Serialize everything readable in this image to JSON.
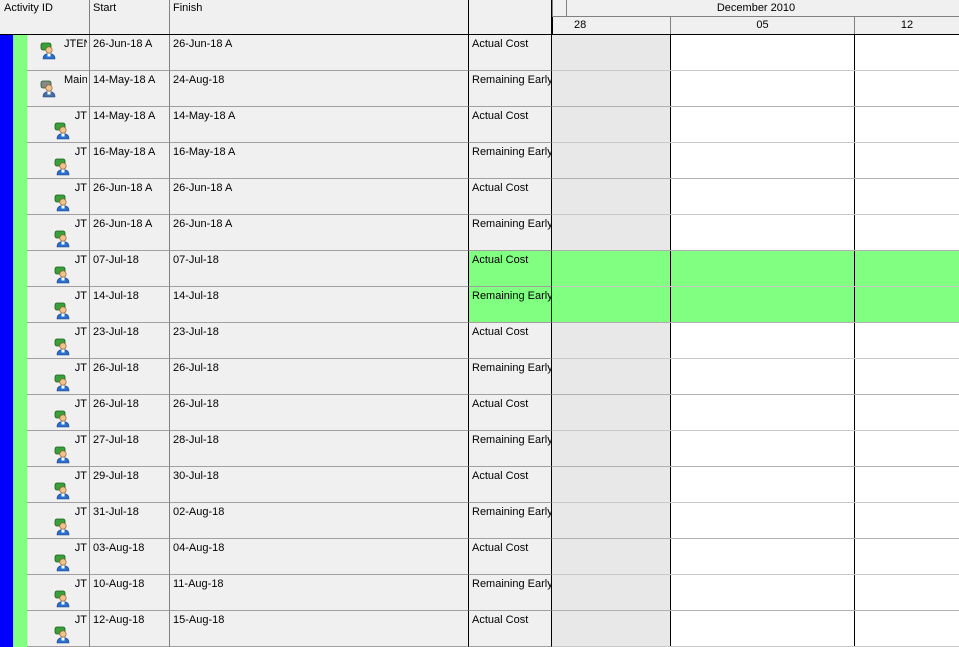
{
  "columns": {
    "activity_id": "Activity ID",
    "start": "Start",
    "finish": "Finish",
    "curve": ""
  },
  "timeline": {
    "month": "December 2010",
    "weeks": [
      "28",
      "05",
      "12"
    ]
  },
  "colors": {
    "band_blue": "#0000ff",
    "band_green": "#80ff80",
    "highlight": "#80ff80"
  },
  "rows": [
    {
      "id": "JTEN",
      "icon": "resource-person-icon",
      "start": "26-Jun-18 A",
      "finish": "26-Jun-18 A",
      "curve": "Actual Cost"
    },
    {
      "id": "Maint",
      "icon": "resource-person-grey-icon",
      "start": "14-May-18 A",
      "finish": "24-Aug-18",
      "curve": "Remaining Early"
    },
    {
      "id": "JT",
      "icon": "resource-person-icon",
      "start": "14-May-18 A",
      "finish": "14-May-18 A",
      "curve": "Actual Cost"
    },
    {
      "id": "JT",
      "icon": "resource-person-icon",
      "start": "16-May-18 A",
      "finish": "16-May-18 A",
      "curve": "Remaining Early"
    },
    {
      "id": "JT",
      "icon": "resource-person-icon",
      "start": "26-Jun-18 A",
      "finish": "26-Jun-18 A",
      "curve": "Actual Cost"
    },
    {
      "id": "JT",
      "icon": "resource-person-icon",
      "start": "26-Jun-18 A",
      "finish": "26-Jun-18 A",
      "curve": "Remaining Early"
    },
    {
      "id": "JT",
      "icon": "resource-person-icon",
      "start": "07-Jul-18",
      "finish": "07-Jul-18",
      "curve": "Actual Cost",
      "highlight": true
    },
    {
      "id": "JT",
      "icon": "resource-person-icon",
      "start": "14-Jul-18",
      "finish": "14-Jul-18",
      "curve": "Remaining Early",
      "highlight": true
    },
    {
      "id": "JT",
      "icon": "resource-person-icon",
      "start": "23-Jul-18",
      "finish": "23-Jul-18",
      "curve": "Actual Cost"
    },
    {
      "id": "JT",
      "icon": "resource-person-icon",
      "start": "26-Jul-18",
      "finish": "26-Jul-18",
      "curve": "Remaining Early"
    },
    {
      "id": "JT",
      "icon": "resource-person-icon",
      "start": "26-Jul-18",
      "finish": "26-Jul-18",
      "curve": "Actual Cost"
    },
    {
      "id": "JT",
      "icon": "resource-person-icon",
      "start": "27-Jul-18",
      "finish": "28-Jul-18",
      "curve": "Remaining Early"
    },
    {
      "id": "JT",
      "icon": "resource-person-icon",
      "start": "29-Jul-18",
      "finish": "30-Jul-18",
      "curve": "Actual Cost"
    },
    {
      "id": "JT",
      "icon": "resource-person-icon",
      "start": "31-Jul-18",
      "finish": "02-Aug-18",
      "curve": "Remaining Early"
    },
    {
      "id": "JT",
      "icon": "resource-person-icon",
      "start": "03-Aug-18",
      "finish": "04-Aug-18",
      "curve": "Actual Cost"
    },
    {
      "id": "JT",
      "icon": "resource-person-icon",
      "start": "10-Aug-18",
      "finish": "11-Aug-18",
      "curve": "Remaining Early"
    },
    {
      "id": "JT",
      "icon": "resource-person-icon",
      "start": "12-Aug-18",
      "finish": "15-Aug-18",
      "curve": "Actual Cost"
    }
  ]
}
